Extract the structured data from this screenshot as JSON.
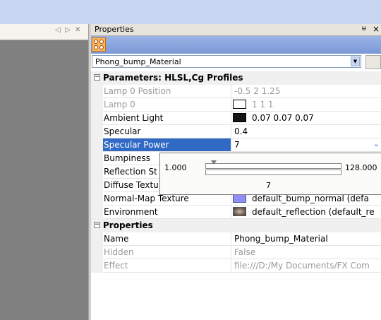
{
  "left_panel": {
    "controls": [
      "◁",
      "▷",
      "✕"
    ]
  },
  "properties": {
    "title": "Properties",
    "pin_glyph": "ᵾ",
    "close_glyph": "×",
    "object_selector": "Phong_bump_Material",
    "categories": [
      {
        "label": "Parameters: HLSL,Cg Profiles",
        "collapse_glyph": "−",
        "rows": [
          {
            "name": "Lamp 0 Position",
            "value": "-0.5 2 1.25",
            "disabled": true
          },
          {
            "name": "Lamp 0",
            "value": "1 1 1",
            "disabled": true,
            "swatch": "#ffffff"
          },
          {
            "name": "Ambient Light",
            "value": "0.07 0.07 0.07",
            "swatch": "#141414"
          },
          {
            "name": "Specular",
            "value": "0.4"
          },
          {
            "name": "Specular Power",
            "value": "7",
            "selected": true
          },
          {
            "name": "Bumpiness",
            "value": ""
          },
          {
            "name": "Reflection St",
            "value": ""
          },
          {
            "name": "Diffuse Textu",
            "value": ""
          },
          {
            "name": "Normal-Map Texture",
            "value": "default_bump_normal (defa",
            "swatch": "#8f8ff5"
          },
          {
            "name": "Environment",
            "value": "default_reflection (default_re",
            "swatch": "#6a5a4e"
          }
        ]
      },
      {
        "label": "Properties",
        "collapse_glyph": "−",
        "rows": [
          {
            "name": "Name",
            "value": "Phong_bump_Material"
          },
          {
            "name": "Hidden",
            "value": "False",
            "disabled": true
          },
          {
            "name": "Effect",
            "value": "file:///D:/My Documents/FX Com",
            "disabled": true
          }
        ]
      }
    ],
    "slider_popup": {
      "min": "1.000",
      "max": "128.000",
      "current": "7",
      "fraction": 0.047
    }
  },
  "colors": {
    "selection": "#316ac5",
    "topband": "#c8d6f2",
    "toolbar": "#7b98d6"
  }
}
